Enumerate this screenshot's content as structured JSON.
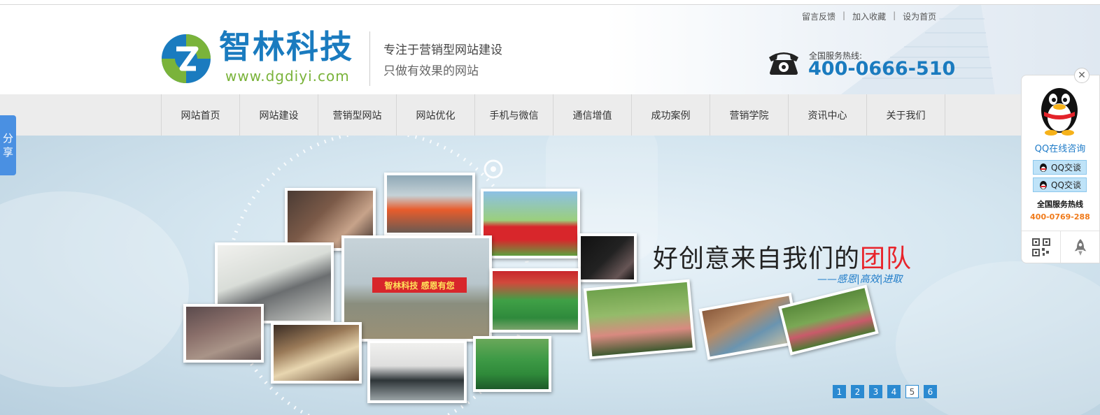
{
  "header": {
    "top_links": [
      "留言反馈",
      "加入收藏",
      "设为首页"
    ],
    "link_separator": "|",
    "logo_title": "智林科技",
    "logo_url": "www.dgdiyi.com",
    "slogan_line1": "专注于营销型网站建设",
    "slogan_line2": "只做有效果的网站",
    "hotline_label": "全国服务热线:",
    "hotline_number": "400-0666-510"
  },
  "nav": {
    "items": [
      "网站首页",
      "网站建设",
      "营销型网站",
      "网站优化",
      "手机与微信",
      "通信增值",
      "成功案例",
      "营销学院",
      "资讯中心",
      "关于我们"
    ]
  },
  "banner": {
    "headline_part1": "好创意来自我们的",
    "headline_highlight": "团队",
    "subline": "——感恩|高效|进取",
    "banner_text_on_flag": "智林科技 感恩有您",
    "pages": [
      "1",
      "2",
      "3",
      "4",
      "5",
      "6"
    ],
    "active_page": "5"
  },
  "share_tab": {
    "label_line1": "分",
    "label_line2": "享"
  },
  "qq_float": {
    "close_symbol": "✕",
    "title": "QQ在线咨询",
    "buttons": [
      "QQ交谈",
      "QQ交谈"
    ],
    "hotline_label": "全国服务热线",
    "hotline_number": "400-0769-288"
  },
  "colors": {
    "brand_blue": "#1a7bbf",
    "brand_green": "#7ab33a",
    "highlight_red": "#e8242b",
    "pager_blue": "#2b8ad1",
    "hotline_orange": "#f07a1a"
  },
  "icons": [
    "logo-mark-icon",
    "phone-icon",
    "qq-penguin-icon",
    "qr-code-icon",
    "rocket-icon"
  ]
}
